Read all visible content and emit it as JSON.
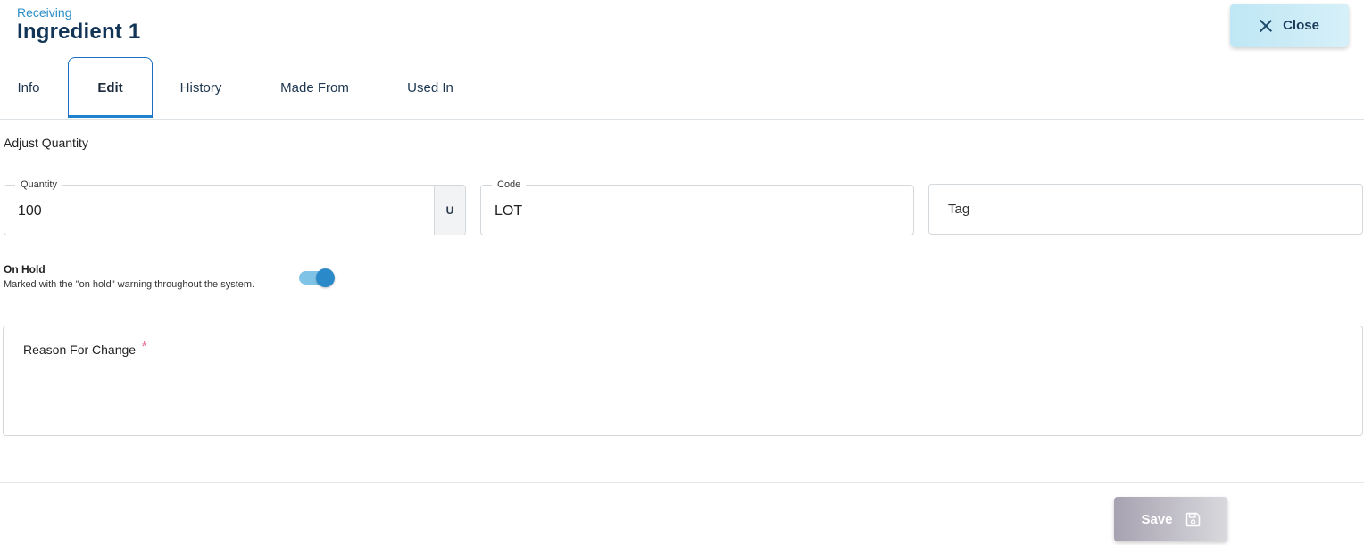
{
  "header": {
    "breadcrumb": "Receiving",
    "title": "Ingredient 1",
    "close_label": "Close"
  },
  "tabs": [
    {
      "label": "Info",
      "active": false
    },
    {
      "label": "Edit",
      "active": true
    },
    {
      "label": "History",
      "active": false
    },
    {
      "label": "Made From",
      "active": false
    },
    {
      "label": "Used In",
      "active": false
    }
  ],
  "form": {
    "section_label": "Adjust Quantity",
    "quantity": {
      "label": "Quantity",
      "value": "100",
      "unit": "U"
    },
    "code": {
      "label": "Code",
      "value": "LOT"
    },
    "tag": {
      "placeholder": "Tag"
    },
    "on_hold": {
      "title": "On Hold",
      "description": "Marked with the \"on hold\" warning throughout the system.",
      "enabled": true
    },
    "reason": {
      "label": "Reason For Change",
      "required_mark": "*",
      "value": ""
    }
  },
  "footer": {
    "save_label": "Save"
  },
  "colors": {
    "accent": "#2a8ac9",
    "title": "#123456",
    "breadcrumb": "#2b8fc7",
    "required": "#e57399"
  },
  "icons": {
    "close": "close-icon",
    "save": "floppy-disk-icon"
  }
}
